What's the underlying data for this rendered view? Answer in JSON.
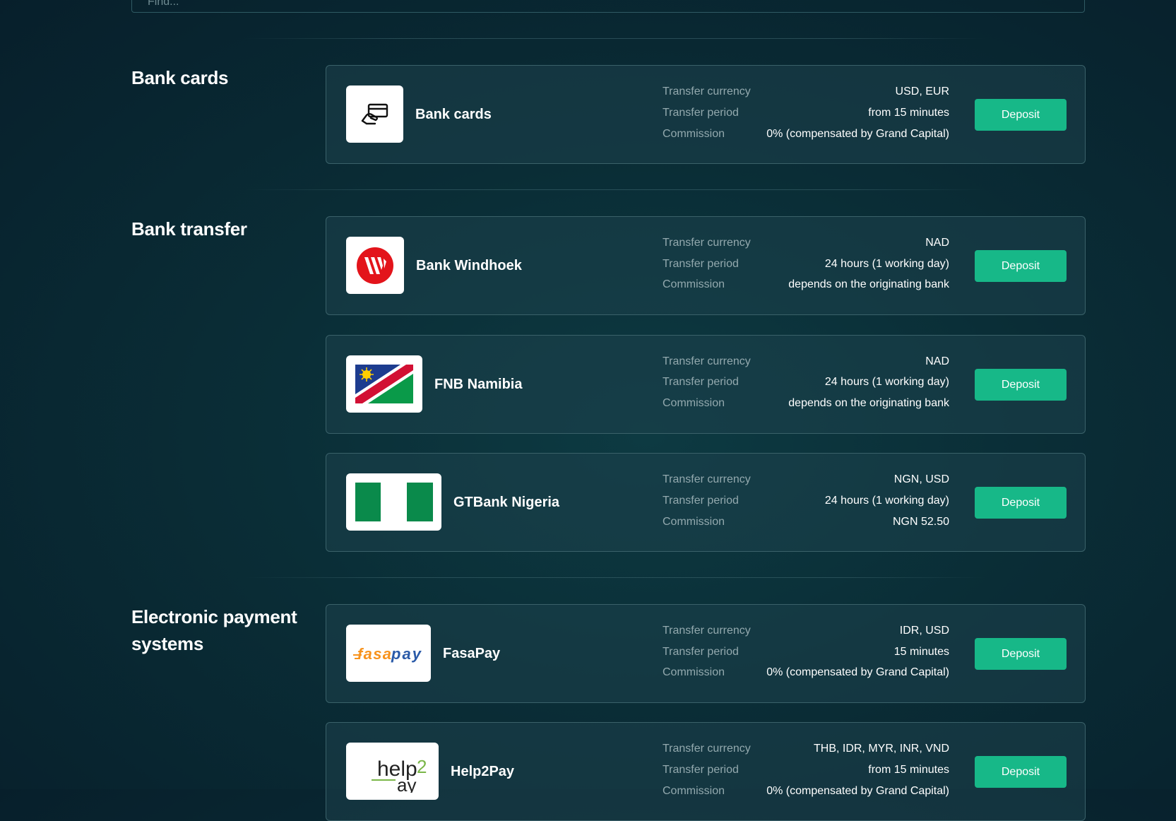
{
  "search": {
    "placeholder": "Find..."
  },
  "sections": [
    {
      "title": "Bank cards",
      "methods": [
        {
          "name": "Bank cards",
          "logo_icon": "card-in-hand-icon",
          "rows": [
            {
              "label": "Transfer currency",
              "value": "USD, EUR"
            },
            {
              "label": "Transfer period",
              "value": "from 15 minutes"
            },
            {
              "label": "Commission",
              "value": "0% (compensated by Grand Capital)"
            }
          ],
          "button": "Deposit"
        }
      ]
    },
    {
      "title": "Bank transfer",
      "methods": [
        {
          "name": "Bank Windhoek",
          "logo_icon": "bank-windhoek-logo",
          "rows": [
            {
              "label": "Transfer currency",
              "value": "NAD"
            },
            {
              "label": "Transfer period",
              "value": "24 hours (1 working day)"
            },
            {
              "label": "Commission",
              "value": "depends on the originating bank"
            }
          ],
          "button": "Deposit"
        },
        {
          "name": "FNB Namibia",
          "logo_icon": "namibia-flag-icon",
          "rows": [
            {
              "label": "Transfer currency",
              "value": "NAD"
            },
            {
              "label": "Transfer period",
              "value": "24 hours (1 working day)"
            },
            {
              "label": "Commission",
              "value": "depends on the originating bank"
            }
          ],
          "button": "Deposit"
        },
        {
          "name": "GTBank Nigeria",
          "logo_icon": "nigeria-flag-icon",
          "rows": [
            {
              "label": "Transfer currency",
              "value": "NGN, USD"
            },
            {
              "label": "Transfer period",
              "value": "24 hours (1 working day)"
            },
            {
              "label": "Commission",
              "value": "NGN 52.50"
            }
          ],
          "button": "Deposit"
        }
      ]
    },
    {
      "title": "Electronic payment systems",
      "methods": [
        {
          "name": "FasaPay",
          "logo_icon": "fasapay-logo",
          "logo_text": "fasapay",
          "rows": [
            {
              "label": "Transfer currency",
              "value": "IDR, USD"
            },
            {
              "label": "Transfer period",
              "value": "15 minutes"
            },
            {
              "label": "Commission",
              "value": "0% (compensated by Grand Capital)"
            }
          ],
          "button": "Deposit"
        },
        {
          "name": "Help2Pay",
          "logo_icon": "help2pay-logo",
          "logo_text": "help2pay",
          "rows": [
            {
              "label": "Transfer currency",
              "value": "THB, IDR, MYR, INR, VND"
            },
            {
              "label": "Transfer period",
              "value": "from 15 minutes"
            },
            {
              "label": "Commission",
              "value": "0% (compensated by Grand Capital)"
            }
          ],
          "button": "Deposit"
        }
      ]
    }
  ],
  "colors": {
    "accent": "#17b888",
    "background": "#0a2d36",
    "card_border": "#3a6169",
    "label_text": "#93a9ae"
  }
}
